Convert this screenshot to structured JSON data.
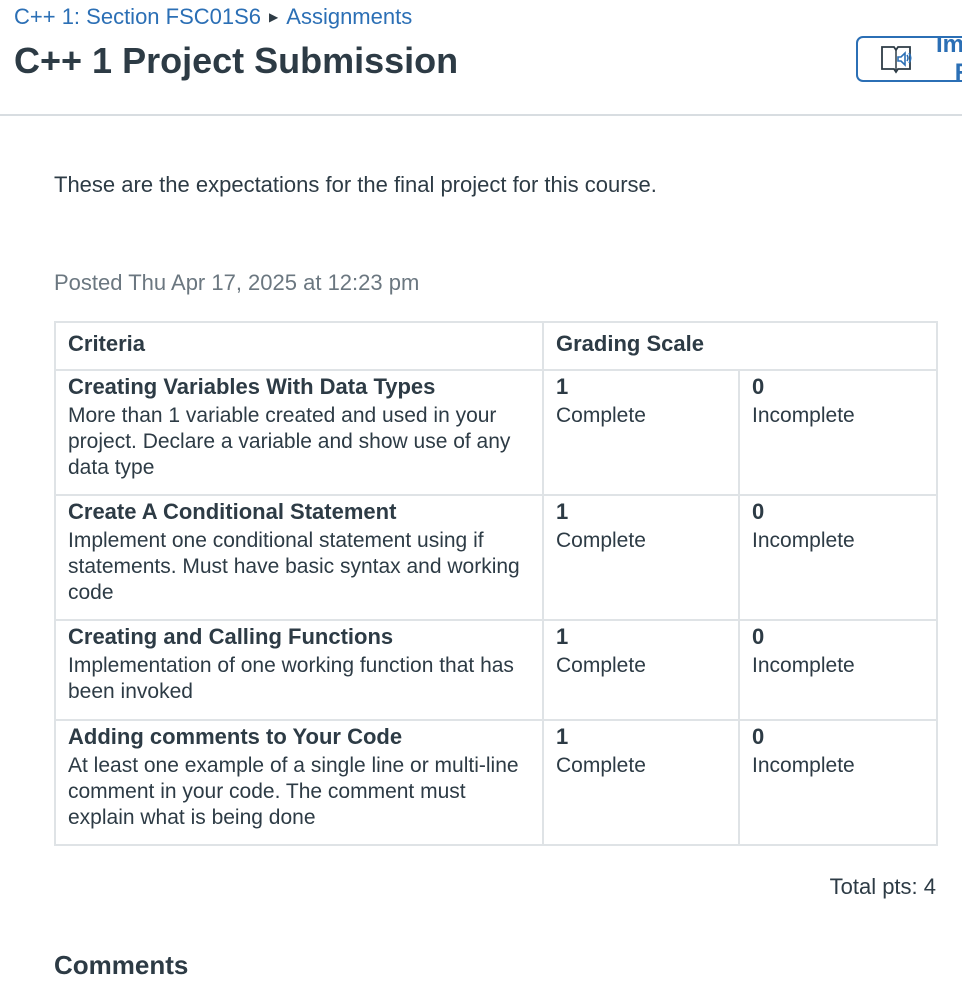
{
  "breadcrumb": {
    "course": "C++ 1: Section FSC01S6",
    "separator": "▶",
    "section": "Assignments"
  },
  "page_title": "C++ 1 Project Submission",
  "immersive_reader": {
    "label": "Immersive Reader",
    "icon": "immersive-reader-icon"
  },
  "description": "These are the expectations for the final project for this course.",
  "posted": "Posted Thu Apr 17, 2025 at 12:23 pm",
  "rubric": {
    "headers": {
      "criteria": "Criteria",
      "grading_scale": "Grading Scale"
    },
    "rows": [
      {
        "title": "Creating Variables With Data Types",
        "description": "More than 1 variable created and used in your project. Declare a variable and show use of any data type",
        "ratings": [
          {
            "points": "1",
            "label": "Complete"
          },
          {
            "points": "0",
            "label": "Incomplete"
          }
        ]
      },
      {
        "title": "Create A Conditional Statement",
        "description": "Implement one conditional statement using if statements. Must have basic syntax and working code",
        "ratings": [
          {
            "points": "1",
            "label": "Complete"
          },
          {
            "points": "0",
            "label": "Incomplete"
          }
        ]
      },
      {
        "title": "Creating and Calling Functions",
        "description": "Implementation of one working function that has been invoked",
        "ratings": [
          {
            "points": "1",
            "label": "Complete"
          },
          {
            "points": "0",
            "label": "Incomplete"
          }
        ]
      },
      {
        "title": "Adding comments to Your Code",
        "description": "At least one example of a single line or multi-line comment in your code. The comment must explain what is being done",
        "ratings": [
          {
            "points": "1",
            "label": "Complete"
          },
          {
            "points": "0",
            "label": "Incomplete"
          }
        ]
      }
    ],
    "total": "Total pts: 4"
  },
  "comments_heading": "Comments",
  "colors": {
    "link": "#2b6fb5",
    "text": "#2d3b45",
    "muted": "#6b7780",
    "border": "#dfe3e6"
  }
}
